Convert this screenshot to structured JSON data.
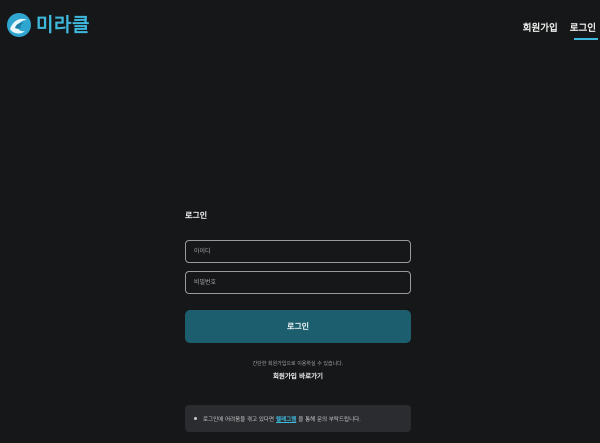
{
  "header": {
    "logo_text": "미라클",
    "nav": [
      {
        "label": "회원가입",
        "active": false
      },
      {
        "label": "로그인",
        "active": true
      }
    ]
  },
  "login": {
    "title": "로그인",
    "id_placeholder": "아이디",
    "password_placeholder": "비밀번호",
    "submit_label": "로그인",
    "signup_hint": "간단한 회원가입으로 이용하실 수 있습니다.",
    "signup_link": "회원가입 바로가기"
  },
  "notice": {
    "text_before": "로그인에 어려움을 겪고 있다면",
    "link": "텔레그램",
    "text_after": "을 통해 문의 부탁드립니다."
  },
  "colors": {
    "background": "#161718",
    "accent": "#3fb8de",
    "button": "#1c5d6e",
    "notice_bg": "#2a2c2f"
  }
}
